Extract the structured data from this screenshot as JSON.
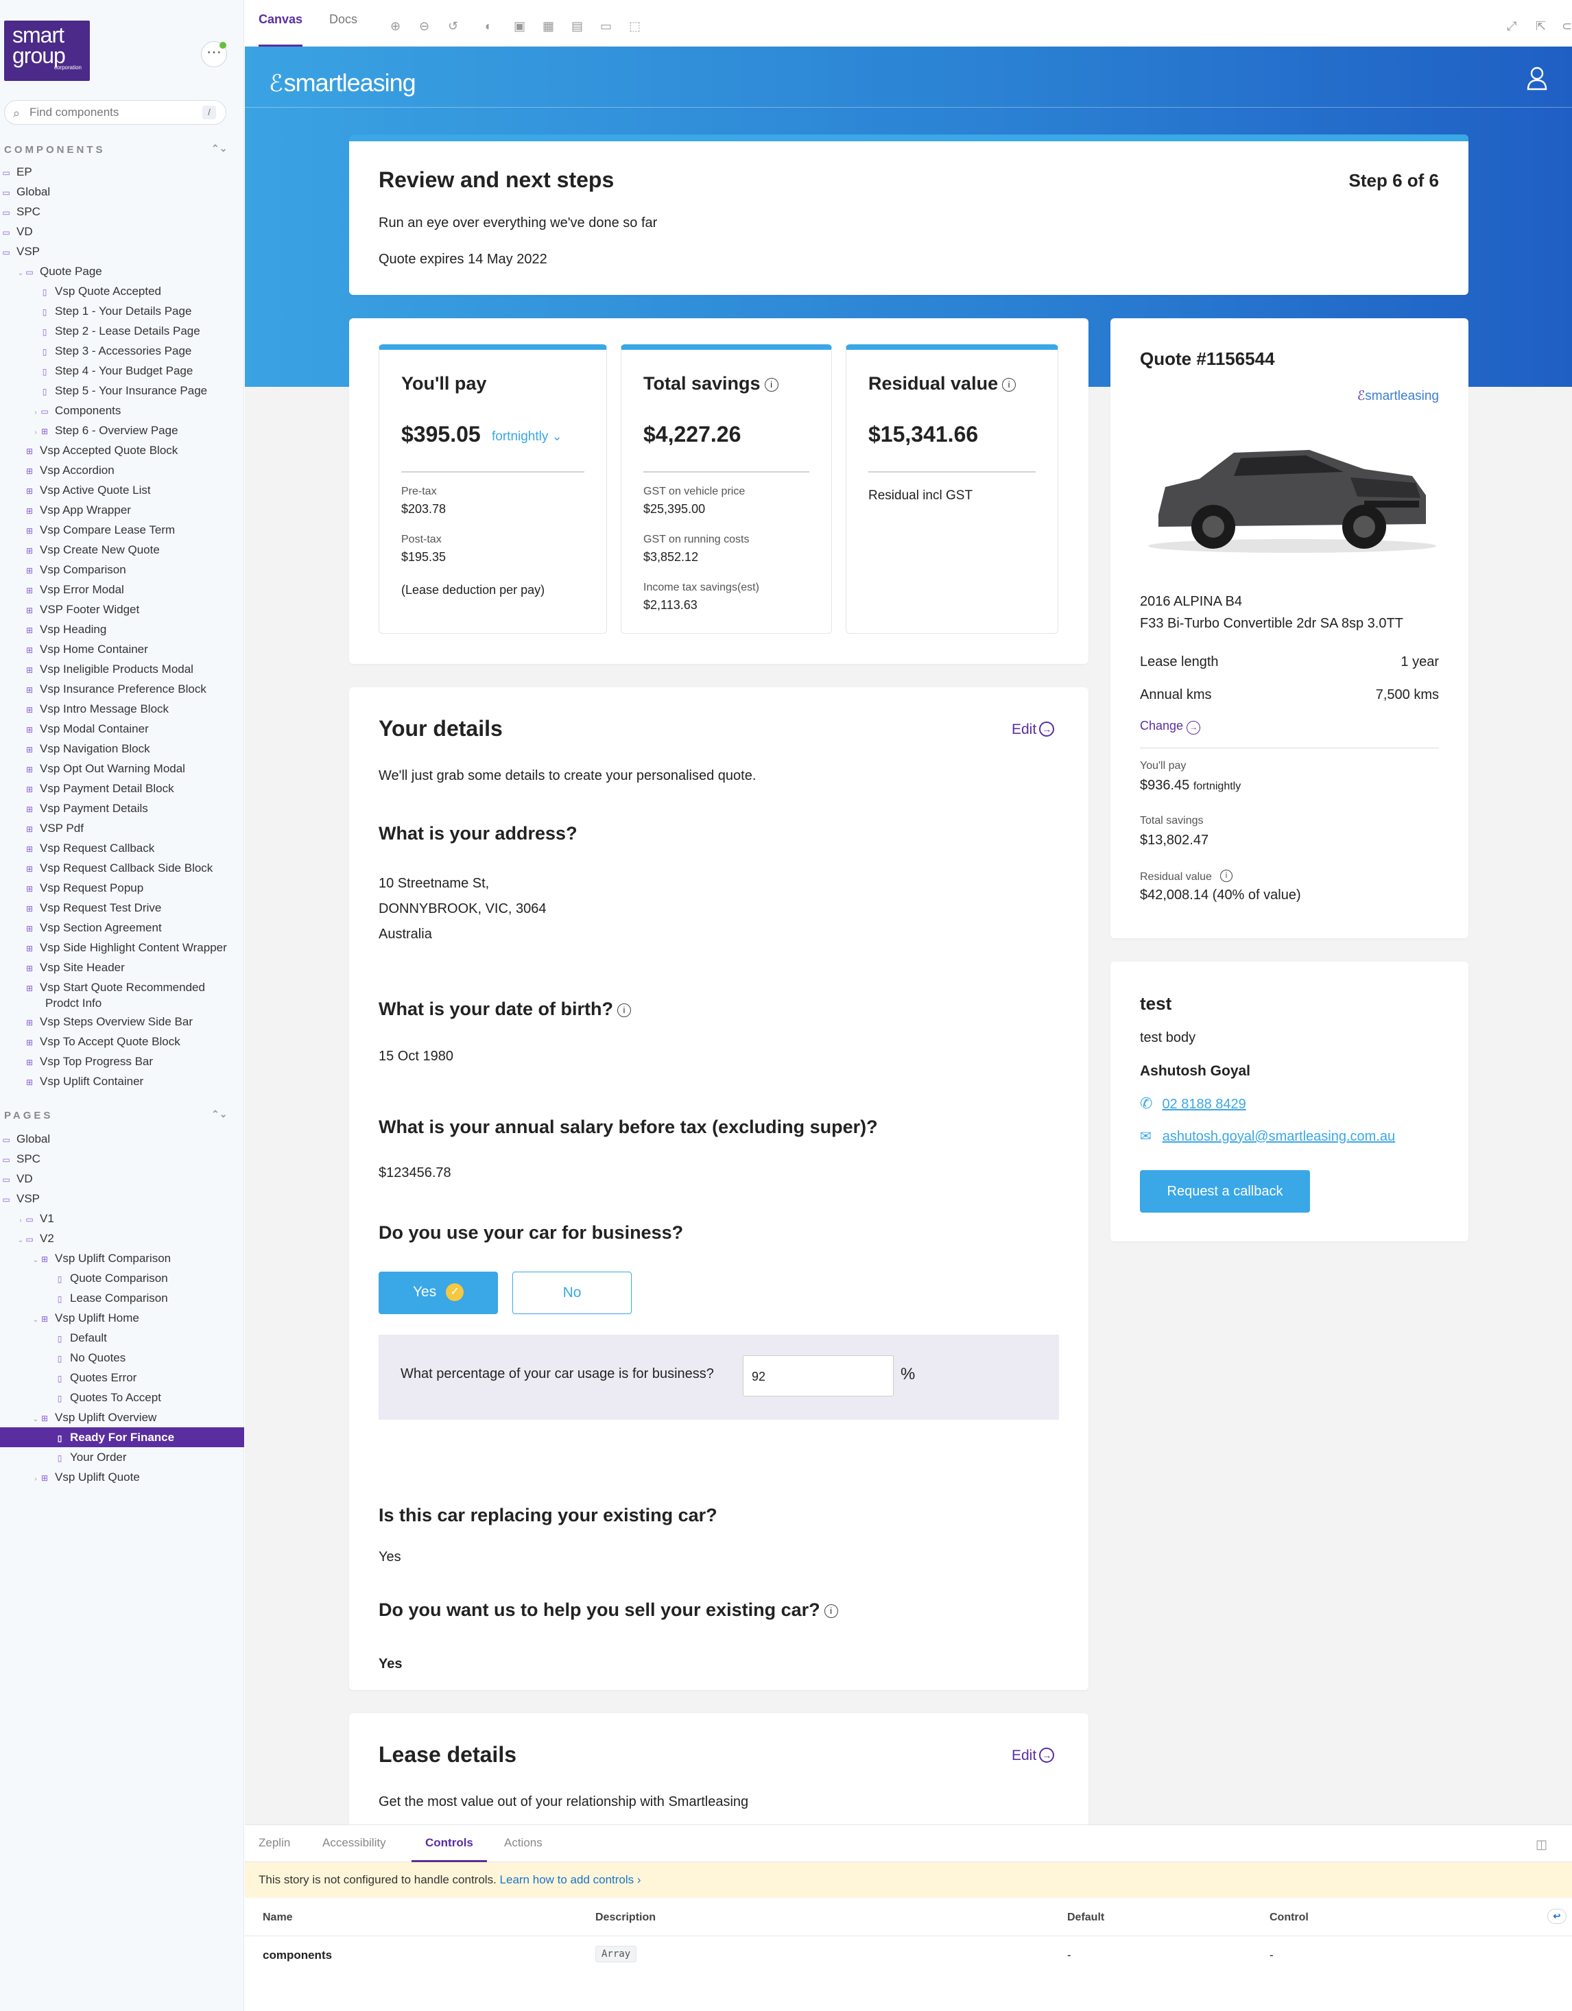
{
  "sidebar": {
    "logo_line1": "smart",
    "logo_line2": "group",
    "logo_sub": "corporation",
    "search_placeholder": "Find components",
    "search_shortcut": "/",
    "components_title": "COMPONENTS",
    "pages_title": "PAGES",
    "components": [
      {
        "label": "EP",
        "level": 0,
        "type": "folder"
      },
      {
        "label": "Global",
        "level": 0,
        "type": "folder"
      },
      {
        "label": "SPC",
        "level": 0,
        "type": "folder"
      },
      {
        "label": "VD",
        "level": 0,
        "type": "folder"
      },
      {
        "label": "VSP",
        "level": 0,
        "type": "folder"
      },
      {
        "label": "Quote Page",
        "level": 1,
        "type": "folder-open"
      },
      {
        "label": "Vsp Quote Accepted",
        "level": 2,
        "type": "story"
      },
      {
        "label": "Step 1 - Your Details Page",
        "level": 2,
        "type": "story"
      },
      {
        "label": "Step 2 - Lease Details Page",
        "level": 2,
        "type": "story"
      },
      {
        "label": "Step 3 - Accessories Page",
        "level": 2,
        "type": "story"
      },
      {
        "label": "Step 4 - Your Budget Page",
        "level": 2,
        "type": "story"
      },
      {
        "label": "Step 5 - Your Insurance Page",
        "level": 2,
        "type": "story"
      },
      {
        "label": "Components",
        "level": 2,
        "type": "folder-c"
      },
      {
        "label": "Step 6 - Overview Page",
        "level": 2,
        "type": "component-c"
      },
      {
        "label": "Vsp Accepted Quote Block",
        "level": 1,
        "type": "component"
      },
      {
        "label": "Vsp Accordion",
        "level": 1,
        "type": "component"
      },
      {
        "label": "Vsp Active Quote List",
        "level": 1,
        "type": "component"
      },
      {
        "label": "Vsp App Wrapper",
        "level": 1,
        "type": "component"
      },
      {
        "label": "Vsp Compare Lease Term",
        "level": 1,
        "type": "component"
      },
      {
        "label": "Vsp Create New Quote",
        "level": 1,
        "type": "component"
      },
      {
        "label": "Vsp Comparison",
        "level": 1,
        "type": "component"
      },
      {
        "label": "Vsp Error Modal",
        "level": 1,
        "type": "component"
      },
      {
        "label": "VSP Footer Widget",
        "level": 1,
        "type": "component"
      },
      {
        "label": "Vsp Heading",
        "level": 1,
        "type": "component"
      },
      {
        "label": "Vsp Home Container",
        "level": 1,
        "type": "component"
      },
      {
        "label": "Vsp Ineligible Products Modal",
        "level": 1,
        "type": "component"
      },
      {
        "label": "Vsp Insurance Preference Block",
        "level": 1,
        "type": "component"
      },
      {
        "label": "Vsp Intro Message Block",
        "level": 1,
        "type": "component"
      },
      {
        "label": "Vsp Modal Container",
        "level": 1,
        "type": "component"
      },
      {
        "label": "Vsp Navigation Block",
        "level": 1,
        "type": "component"
      },
      {
        "label": "Vsp Opt Out Warning Modal",
        "level": 1,
        "type": "component"
      },
      {
        "label": "Vsp Payment Detail Block",
        "level": 1,
        "type": "component"
      },
      {
        "label": "Vsp Payment Details",
        "level": 1,
        "type": "component"
      },
      {
        "label": "VSP Pdf",
        "level": 1,
        "type": "component"
      },
      {
        "label": "Vsp Request Callback",
        "level": 1,
        "type": "component"
      },
      {
        "label": "Vsp Request Callback Side Block",
        "level": 1,
        "type": "component"
      },
      {
        "label": "Vsp Request Popup",
        "level": 1,
        "type": "component"
      },
      {
        "label": "Vsp Request Test Drive",
        "level": 1,
        "type": "component"
      },
      {
        "label": "Vsp Section Agreement",
        "level": 1,
        "type": "component"
      },
      {
        "label": "Vsp Side Highlight Content Wrapper",
        "level": 1,
        "type": "component"
      },
      {
        "label": "Vsp Site Header",
        "level": 1,
        "type": "component"
      },
      {
        "label": "Vsp Start Quote Recommended",
        "label2": "Prodct Info",
        "level": 1,
        "type": "component"
      },
      {
        "label": "Vsp Steps Overview Side Bar",
        "level": 1,
        "type": "component"
      },
      {
        "label": "Vsp To Accept Quote Block",
        "level": 1,
        "type": "component"
      },
      {
        "label": "Vsp Top Progress Bar",
        "level": 1,
        "type": "component"
      },
      {
        "label": "Vsp Uplift Container",
        "level": 1,
        "type": "component"
      }
    ],
    "pages": [
      {
        "label": "Global",
        "level": 0,
        "type": "folder"
      },
      {
        "label": "SPC",
        "level": 0,
        "type": "folder"
      },
      {
        "label": "VD",
        "level": 0,
        "type": "folder"
      },
      {
        "label": "VSP",
        "level": 0,
        "type": "folder"
      },
      {
        "label": "V1",
        "level": 1,
        "type": "folder-c"
      },
      {
        "label": "V2",
        "level": 1,
        "type": "folder-open"
      },
      {
        "label": "Vsp Uplift Comparison",
        "level": 2,
        "type": "component-open"
      },
      {
        "label": "Quote Comparison",
        "level": 3,
        "type": "story"
      },
      {
        "label": "Lease Comparison",
        "level": 3,
        "type": "story"
      },
      {
        "label": "Vsp Uplift Home",
        "level": 2,
        "type": "component-open"
      },
      {
        "label": "Default",
        "level": 3,
        "type": "story"
      },
      {
        "label": "No Quotes",
        "level": 3,
        "type": "story"
      },
      {
        "label": "Quotes Error",
        "level": 3,
        "type": "story"
      },
      {
        "label": "Quotes To Accept",
        "level": 3,
        "type": "story"
      },
      {
        "label": "Vsp Uplift Overview",
        "level": 2,
        "type": "component-open"
      },
      {
        "label": "Ready For Finance",
        "level": 3,
        "type": "story",
        "selected": true
      },
      {
        "label": "Your Order",
        "level": 3,
        "type": "story"
      },
      {
        "label": "Vsp Uplift Quote",
        "level": 2,
        "type": "component-c"
      }
    ]
  },
  "toolbar": {
    "tab_canvas": "Canvas",
    "tab_docs": "Docs"
  },
  "site": {
    "brand": "smartleasing",
    "review_title": "Review and next steps",
    "step": "Step 6 of 6",
    "review_sub": "Run an eye over everything we've done so far",
    "quote_expires": "Quote expires 14 May 2022"
  },
  "pay": {
    "title": "You'll pay",
    "value": "$395.05",
    "frequency": "fortnightly",
    "pretax_label": "Pre-tax",
    "pretax_value": "$203.78",
    "posttax_label": "Post-tax",
    "posttax_value": "$195.35",
    "note": "(Lease deduction per pay)"
  },
  "savings": {
    "title": "Total savings",
    "value": "$4,227.26",
    "gst_vehicle_label": "GST on vehicle price",
    "gst_vehicle_value": "$25,395.00",
    "gst_running_label": "GST on running costs",
    "gst_running_value": "$3,852.12",
    "income_label": "Income tax savings(est)",
    "income_value": "$2,113.63"
  },
  "residual": {
    "title": "Residual value",
    "value": "$15,341.66",
    "note": "Residual incl GST"
  },
  "details": {
    "title": "Your details",
    "edit": "Edit",
    "intro": "We'll just grab some details to create your personalised quote.",
    "q_address": "What is your address?",
    "address_1": "10 Streetname St,",
    "address_2": "DONNYBROOK, VIC, 3064",
    "address_3": "Australia",
    "q_dob": "What is your date of birth?",
    "dob": "15 Oct 1980",
    "q_salary": "What is your annual salary before tax (excluding super)?",
    "salary": "$123456.78",
    "q_business": "Do you use your car for business?",
    "yes": "Yes",
    "no": "No",
    "q_percent": "What percentage of your car usage is for business?",
    "percent_value": "92",
    "percent_sign": "%",
    "q_replacing": "Is this car replacing your existing car?",
    "replacing": "Yes",
    "q_sell": "Do you want us to help you sell your existing car?",
    "sell": "Yes"
  },
  "lease": {
    "title": "Lease details",
    "edit": "Edit",
    "intro": "Get the most value out of your relationship with Smartleasing"
  },
  "quote": {
    "title": "Quote #1156544",
    "brand": "smartleasing",
    "car_line1": "2016 ALPINA B4",
    "car_line2": "F33 Bi-Turbo Convertible 2dr SA 8sp 3.0TT",
    "lease_length_label": "Lease length",
    "lease_length_value": "1 year",
    "annual_kms_label": "Annual kms",
    "annual_kms_value": "7,500 kms",
    "change": "Change",
    "pay_label": "You'll pay",
    "pay_value": "$936.45",
    "pay_freq": "fortnightly",
    "savings_label": "Total savings",
    "savings_value": "$13,802.47",
    "residual_label": "Residual value",
    "residual_value": "$42,008.14 (40% of value)"
  },
  "contact": {
    "title": "test",
    "body": "test body",
    "name": "Ashutosh Goyal",
    "phone": "02 8188 8429",
    "email": "ashutosh.goyal@smartleasing.com.au",
    "callback": "Request a callback"
  },
  "addons": {
    "tabs": [
      "Zeplin",
      "Accessibility",
      "Controls",
      "Actions"
    ],
    "active_tab": "Controls",
    "notice": "This story is not configured to handle controls.",
    "notice_link": "Learn how to add controls",
    "col_name": "Name",
    "col_description": "Description",
    "col_default": "Default",
    "col_control": "Control",
    "row_name": "components",
    "row_type": "Array",
    "row_default": "-",
    "row_control": "-"
  },
  "colors": {
    "accent": "#5a2ea0",
    "brand_blue": "#3aa7e6",
    "hero_start": "#3aa3e2",
    "hero_end": "#1f5fc4",
    "notice_bg": "#fff6d9"
  }
}
